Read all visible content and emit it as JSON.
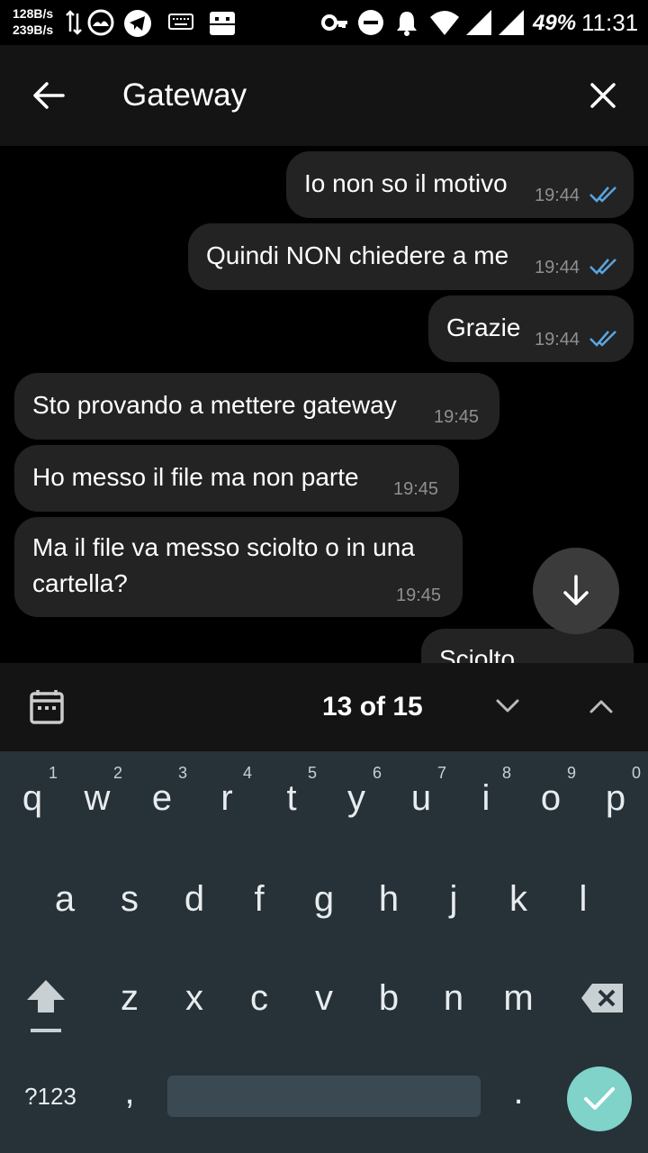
{
  "status_bar": {
    "net_up": "128B/s",
    "net_down": "239B/s",
    "battery": "49%",
    "time": "11:31"
  },
  "app_bar": {
    "title": "Gateway"
  },
  "messages": [
    {
      "text": "Io non so il motivo",
      "time": "19:44",
      "outgoing": true,
      "read": true
    },
    {
      "text": "Quindi NON chiedere a me",
      "time": "19:44",
      "outgoing": true,
      "read": true
    },
    {
      "text": "Grazie",
      "time": "19:44",
      "outgoing": true,
      "read": true
    },
    {
      "text": "Sto provando a mettere gateway",
      "time": "19:45",
      "outgoing": false
    },
    {
      "text": "Ho messo il file ma non parte",
      "time": "19:45",
      "outgoing": false
    },
    {
      "line1": "Ma il file va messo sciolto o in una",
      "line2": "cartella?",
      "time": "19:45",
      "outgoing": false
    },
    {
      "text": "Sciolto",
      "outgoing": true,
      "partially_visible": true
    }
  ],
  "search_bar": {
    "counter": "13 of 15"
  },
  "keyboard": {
    "row1": [
      "q",
      "w",
      "e",
      "r",
      "t",
      "y",
      "u",
      "i",
      "o",
      "p"
    ],
    "row1_hints": [
      "1",
      "2",
      "3",
      "4",
      "5",
      "6",
      "7",
      "8",
      "9",
      "0"
    ],
    "row2": [
      "a",
      "s",
      "d",
      "f",
      "g",
      "h",
      "j",
      "k",
      "l"
    ],
    "row3": [
      "z",
      "x",
      "c",
      "v",
      "b",
      "n",
      "m"
    ],
    "symbols": "?123",
    "comma": ",",
    "period": "."
  },
  "colors": {
    "background": "#000000",
    "bar": "#141414",
    "bubble": "#232323",
    "read_ticks": "#5aa6e0",
    "keyboard": "#263238",
    "done_button": "#7fd3c9"
  },
  "icons": [
    "arrow-back-icon",
    "close-icon",
    "calendar-icon",
    "chevron-down-icon",
    "chevron-up-icon",
    "arrow-down-icon",
    "shift-icon",
    "backspace-icon",
    "check-icon",
    "double-check-icon"
  ]
}
